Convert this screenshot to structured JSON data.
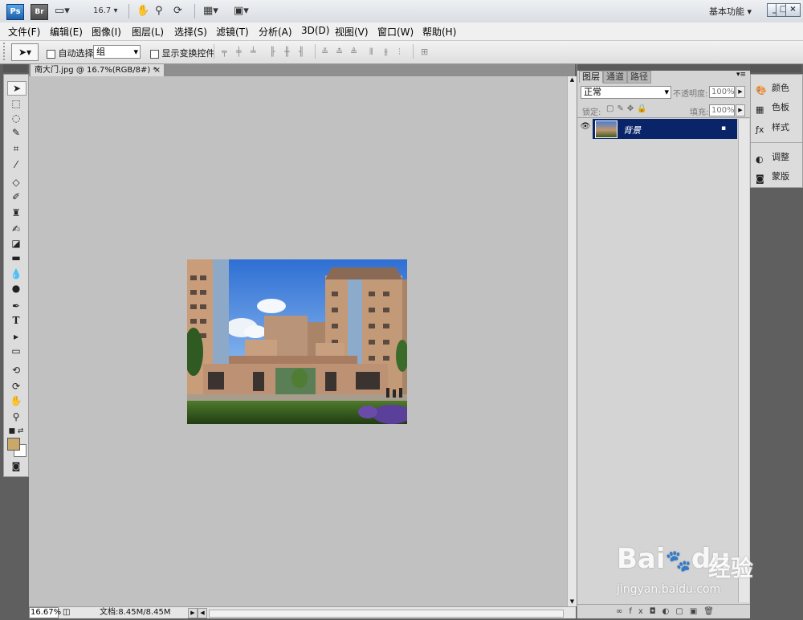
{
  "titlebar": {
    "ps_logo": "Ps",
    "br_logo": "Br",
    "zoom": "16.7",
    "workspace": "基本功能"
  },
  "menu": [
    "文件(F)",
    "编辑(E)",
    "图像(I)",
    "图层(L)",
    "选择(S)",
    "滤镜(T)",
    "分析(A)",
    "3D(D)",
    "视图(V)",
    "窗口(W)",
    "帮助(H)"
  ],
  "options": {
    "auto_select_label": "自动选择:",
    "auto_select_value": "组",
    "show_transform_label": "显示变换控件"
  },
  "document": {
    "tab_title": "南大门.jpg @ 16.7%(RGB/8#) *",
    "close": "×"
  },
  "status": {
    "zoom": "16.67%",
    "doc_info": "文档:8.45M/8.45M"
  },
  "layers_panel": {
    "tabs": [
      "图层",
      "通道",
      "路径"
    ],
    "blend_mode": "正常",
    "opacity_label": "不透明度:",
    "opacity": "100%",
    "lock_label": "锁定:",
    "fill_label": "填充:",
    "fill": "100%",
    "layer_name": "背景"
  },
  "dock": {
    "items": [
      "颜色",
      "色板",
      "样式",
      "调整",
      "蒙版"
    ]
  },
  "watermark": {
    "brand": "Bai",
    "brand2": "du",
    "text": "经验",
    "url": "jingyan.baidu.com"
  },
  "colors": {
    "selection": "#0a246a",
    "canvas": "#c1c1c1",
    "foreground": "#c9a86a"
  }
}
